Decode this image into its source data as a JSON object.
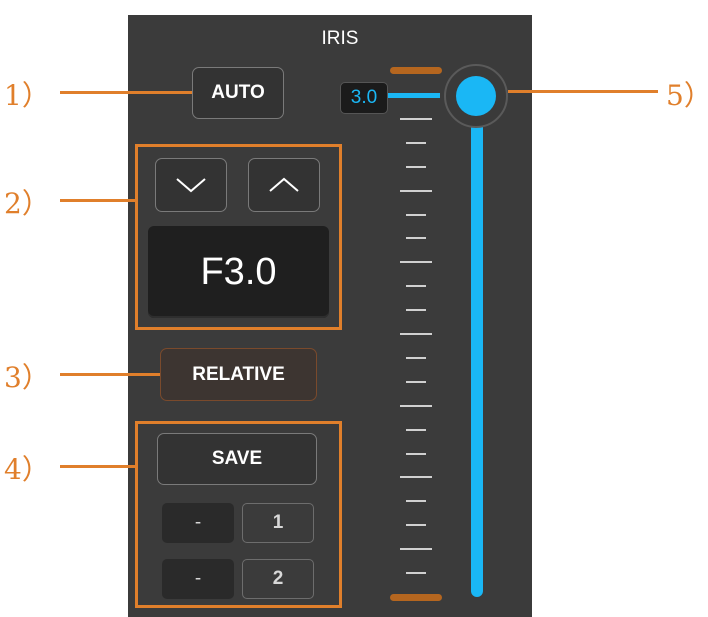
{
  "panel": {
    "title": "IRIS",
    "auto_label": "AUTO",
    "aperture_value": "F3.0",
    "relative_label": "RELATIVE",
    "save_label": "SAVE",
    "presets": [
      {
        "value": "-",
        "slot": "1"
      },
      {
        "value": "-",
        "slot": "2"
      }
    ],
    "slider_value": "3.0",
    "slider_level_fraction": 1.0
  },
  "callouts": [
    "1）",
    "2）",
    "3）",
    "4）",
    "5）"
  ],
  "colors": {
    "panel_bg": "#3b3b3b",
    "accent_blue": "#1ab7f5",
    "callout_orange": "#e07f2b",
    "limit_orange": "#b5661f"
  },
  "icons": {
    "down": "chevron-down-icon",
    "up": "chevron-up-icon"
  }
}
